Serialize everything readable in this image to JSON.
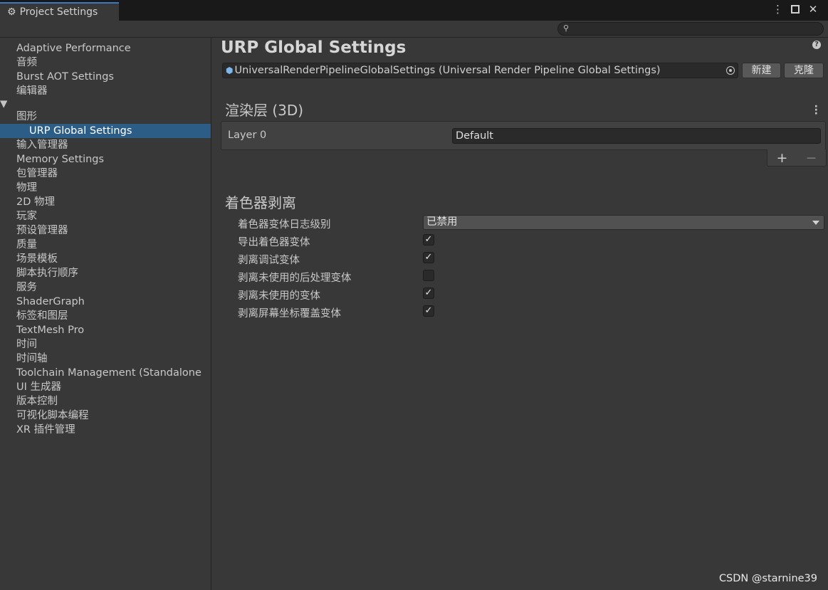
{
  "window": {
    "tab_title": "Project Settings",
    "tab_icon": "gear-icon",
    "controls": [
      "kebab-menu-icon",
      "maximize-icon",
      "close-icon"
    ]
  },
  "search": {
    "value": ""
  },
  "sidebar": {
    "items": [
      {
        "label": "Adaptive Performance"
      },
      {
        "label": "音频"
      },
      {
        "label": "Burst AOT Settings"
      },
      {
        "label": "编辑器"
      },
      {
        "label": "图形",
        "expanded": true
      },
      {
        "label": "URP Global Settings",
        "child": true,
        "selected": true
      },
      {
        "label": "输入管理器"
      },
      {
        "label": "Memory Settings"
      },
      {
        "label": "包管理器"
      },
      {
        "label": "物理"
      },
      {
        "label": "2D 物理"
      },
      {
        "label": "玩家"
      },
      {
        "label": "预设管理器"
      },
      {
        "label": "质量"
      },
      {
        "label": "场景模板"
      },
      {
        "label": "脚本执行顺序"
      },
      {
        "label": "服务"
      },
      {
        "label": "ShaderGraph"
      },
      {
        "label": "标签和图层"
      },
      {
        "label": "TextMesh Pro"
      },
      {
        "label": "时间"
      },
      {
        "label": "时间轴"
      },
      {
        "label": "Toolchain Management (Standalone"
      },
      {
        "label": "UI 生成器"
      },
      {
        "label": "版本控制"
      },
      {
        "label": "可视化脚本编程"
      },
      {
        "label": "XR 插件管理"
      }
    ]
  },
  "main": {
    "title": "URP Global Settings",
    "object_field": "UniversalRenderPipelineGlobalSettings (Universal Render Pipeline Global Settings)",
    "new_button": "新建",
    "clone_button": "克隆",
    "render_layers": {
      "title": "渲染层 (3D)",
      "layer_label": "Layer 0",
      "layer_value": "Default",
      "add": "+",
      "remove": "−"
    },
    "shader_stripping": {
      "title": "着色器剥离",
      "log_level_label": "着色器变体日志级别",
      "log_level_value": "已禁用",
      "options": [
        {
          "label": "导出着色器变体",
          "checked": true
        },
        {
          "label": "剥离调试变体",
          "checked": true
        },
        {
          "label": "剥离未使用的后处理变体",
          "checked": false
        },
        {
          "label": "剥离未使用的变体",
          "checked": true
        },
        {
          "label": "剥离屏幕坐标覆盖变体",
          "checked": true
        }
      ]
    }
  },
  "watermark": "CSDN @starnine39",
  "colors": {
    "background": "#383838",
    "selection": "#2c5d87",
    "tab_accent": "#3a79bb"
  }
}
